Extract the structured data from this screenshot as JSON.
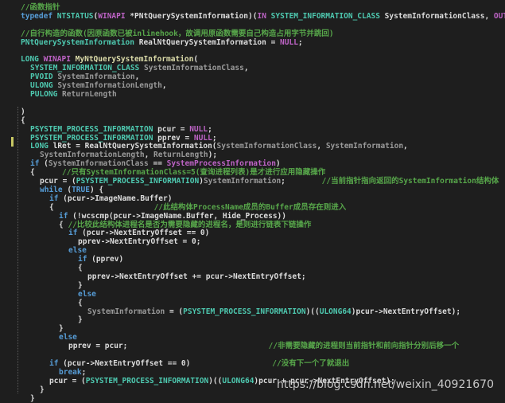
{
  "watermark": "https://blog.csdn.net/weixin_40921670",
  "lines": [
    {
      "indent": 0,
      "tokens": [
        [
          "com",
          "//函数指针"
        ]
      ]
    },
    {
      "indent": 0,
      "tokens": [
        [
          "kw",
          "typedef "
        ],
        [
          "type",
          "NTSTATUS"
        ],
        [
          "plain",
          "("
        ],
        [
          "macro",
          "WINAPI "
        ],
        [
          "plain",
          "*PNtQuerySystemInformation)("
        ],
        [
          "macro",
          "IN "
        ],
        [
          "type",
          "SYSTEM_INFORMATION_CLASS "
        ],
        [
          "plain",
          "SystemInformationClass, "
        ],
        [
          "macro",
          "OUT PV"
        ]
      ]
    },
    {
      "indent": 0,
      "tokens": []
    },
    {
      "indent": 0,
      "tokens": [
        [
          "com",
          "//自行构造的函数(因原函数已被inlinehook，故调用原函数需要自己构造占用字节并跳回)"
        ]
      ]
    },
    {
      "indent": 0,
      "tokens": [
        [
          "type",
          "PNtQuerySystemInformation "
        ],
        [
          "plain",
          "RealNtQuerySystemInformation = "
        ],
        [
          "macro",
          "NULL"
        ],
        [
          "plain",
          ";"
        ]
      ]
    },
    {
      "indent": 0,
      "tokens": []
    },
    {
      "indent": 0,
      "tokens": [
        [
          "type",
          "LONG "
        ],
        [
          "macro",
          "WINAPI "
        ],
        [
          "fn",
          "MyNtQuerySystemInformation"
        ],
        [
          "plain",
          "("
        ]
      ]
    },
    {
      "indent": 1,
      "tokens": [
        [
          "type",
          "SYSTEM_INFORMATION_CLASS "
        ],
        [
          "param",
          "SystemInformationClass"
        ],
        [
          "plain",
          ","
        ]
      ]
    },
    {
      "indent": 1,
      "tokens": [
        [
          "type",
          "PVOID "
        ],
        [
          "param",
          "SystemInformation"
        ],
        [
          "plain",
          ","
        ]
      ]
    },
    {
      "indent": 1,
      "tokens": [
        [
          "type",
          "ULONG "
        ],
        [
          "param",
          "SystemInformationLength"
        ],
        [
          "plain",
          ","
        ]
      ]
    },
    {
      "indent": 1,
      "tokens": [
        [
          "type",
          "PULONG "
        ],
        [
          "param",
          "ReturnLength"
        ]
      ]
    },
    {
      "indent": 0,
      "tokens": []
    },
    {
      "indent": 0,
      "tokens": [
        [
          "plain",
          ")"
        ]
      ]
    },
    {
      "indent": 0,
      "tokens": [
        [
          "plain",
          "{"
        ]
      ]
    },
    {
      "indent": 1,
      "tokens": [
        [
          "type",
          "PSYSTEM_PROCESS_INFORMATION "
        ],
        [
          "plain",
          "pcur = "
        ],
        [
          "macro",
          "NULL"
        ],
        [
          "plain",
          ";"
        ]
      ]
    },
    {
      "indent": 1,
      "tokens": [
        [
          "type",
          "PSYSTEM_PROCESS_INFORMATION "
        ],
        [
          "plain",
          "pprev = "
        ],
        [
          "macro",
          "NULL"
        ],
        [
          "plain",
          ";"
        ]
      ]
    },
    {
      "indent": 1,
      "tokens": [
        [
          "type",
          "LONG "
        ],
        [
          "plain",
          "lRet = RealNtQuerySystemInformation("
        ],
        [
          "param",
          "SystemInformationClass"
        ],
        [
          "plain",
          ", "
        ],
        [
          "param",
          "SystemInformation"
        ],
        [
          "plain",
          ","
        ]
      ]
    },
    {
      "indent": 2,
      "tokens": [
        [
          "param",
          "SystemInformationLength"
        ],
        [
          "plain",
          ", "
        ],
        [
          "param",
          "ReturnLength"
        ],
        [
          "plain",
          ");"
        ]
      ]
    },
    {
      "indent": 1,
      "tokens": [
        [
          "kw",
          "if "
        ],
        [
          "plain",
          "("
        ],
        [
          "param",
          "SystemInformationClass "
        ],
        [
          "plain",
          "== "
        ],
        [
          "macro",
          "SystemProcessInformation"
        ],
        [
          "plain",
          ")"
        ]
      ]
    },
    {
      "indent": 1,
      "tokens": [
        [
          "plain",
          "{      "
        ],
        [
          "com",
          "//只有SystemInformationClass=5(查询进程列表)是才进行应用隐藏操作"
        ]
      ]
    },
    {
      "indent": 2,
      "tokens": [
        [
          "plain",
          "pcur = ("
        ],
        [
          "type",
          "PSYSTEM_PROCESS_INFORMATION"
        ],
        [
          "plain",
          ")"
        ],
        [
          "param",
          "SystemInformation"
        ],
        [
          "plain",
          ";        "
        ],
        [
          "com",
          "//当前指针指向返回的SystemInformation结构体"
        ]
      ]
    },
    {
      "indent": 2,
      "tokens": [
        [
          "kw",
          "while "
        ],
        [
          "plain",
          "("
        ],
        [
          "kw",
          "TRUE"
        ],
        [
          "plain",
          ") {"
        ]
      ]
    },
    {
      "indent": 3,
      "tokens": [
        [
          "kw",
          "if "
        ],
        [
          "plain",
          "(pcur->ImageName.Buffer)"
        ]
      ]
    },
    {
      "indent": 3,
      "tokens": [
        [
          "plain",
          "{                      "
        ],
        [
          "com",
          "//此结构体ProcessName成员的Buffer成员存在则进入"
        ]
      ]
    },
    {
      "indent": 4,
      "tokens": [
        [
          "kw",
          "if "
        ],
        [
          "plain",
          "(!wcscmp(pcur->ImageName.Buffer, Hide_Process))"
        ]
      ]
    },
    {
      "indent": 4,
      "tokens": [
        [
          "plain",
          "{ "
        ],
        [
          "com",
          "//比较此结构体进程名是否为需要隐藏的进程名，是则进行链表下链操作"
        ]
      ]
    },
    {
      "indent": 5,
      "tokens": [
        [
          "kw",
          "if "
        ],
        [
          "plain",
          "(pcur->NextEntryOffset == 0)"
        ]
      ]
    },
    {
      "indent": 6,
      "tokens": [
        [
          "plain",
          "pprev->NextEntryOffset = 0;"
        ]
      ]
    },
    {
      "indent": 5,
      "tokens": [
        [
          "kw",
          "else"
        ]
      ]
    },
    {
      "indent": 6,
      "tokens": [
        [
          "kw",
          "if "
        ],
        [
          "plain",
          "(pprev)"
        ]
      ]
    },
    {
      "indent": 6,
      "tokens": [
        [
          "plain",
          "{"
        ]
      ]
    },
    {
      "indent": 7,
      "tokens": [
        [
          "plain",
          "pprev->NextEntryOffset += pcur->NextEntryOffset;"
        ]
      ]
    },
    {
      "indent": 6,
      "tokens": [
        [
          "plain",
          "}"
        ]
      ]
    },
    {
      "indent": 6,
      "tokens": [
        [
          "kw",
          "else"
        ]
      ]
    },
    {
      "indent": 6,
      "tokens": [
        [
          "plain",
          "{"
        ]
      ]
    },
    {
      "indent": 7,
      "tokens": [
        [
          "param",
          "SystemInformation "
        ],
        [
          "plain",
          "= ("
        ],
        [
          "type",
          "PSYSTEM_PROCESS_INFORMATION"
        ],
        [
          "plain",
          ")(("
        ],
        [
          "type",
          "ULONG64"
        ],
        [
          "plain",
          ")pcur->NextEntryOffset);"
        ]
      ]
    },
    {
      "indent": 6,
      "tokens": [
        [
          "plain",
          "}"
        ]
      ]
    },
    {
      "indent": 4,
      "tokens": [
        [
          "plain",
          "}"
        ]
      ]
    },
    {
      "indent": 4,
      "tokens": [
        [
          "kw",
          "else"
        ]
      ]
    },
    {
      "indent": 5,
      "tokens": [
        [
          "plain",
          "pprev = pcur;                               "
        ],
        [
          "com",
          "//非需要隐藏的进程则当前指针和前向指针分别后移一个"
        ]
      ]
    },
    {
      "indent": 3,
      "tokens": []
    },
    {
      "indent": 3,
      "tokens": [
        [
          "kw",
          "if "
        ],
        [
          "plain",
          "(pcur->NextEntryOffset == 0)                  "
        ],
        [
          "com",
          "//没有下一个了就退出"
        ]
      ]
    },
    {
      "indent": 4,
      "tokens": [
        [
          "kw",
          "break"
        ],
        [
          "plain",
          ";"
        ]
      ]
    },
    {
      "indent": 3,
      "tokens": [
        [
          "plain",
          "pcur = ("
        ],
        [
          "type",
          "PSYSTEM_PROCESS_INFORMATION"
        ],
        [
          "plain",
          ")(("
        ],
        [
          "type",
          "ULONG64"
        ],
        [
          "plain",
          ")pcur + pcur->NextEntryOffset);"
        ]
      ]
    },
    {
      "indent": 2,
      "tokens": [
        [
          "plain",
          "}"
        ]
      ]
    },
    {
      "indent": 1,
      "tokens": [
        [
          "plain",
          "}"
        ]
      ]
    }
  ]
}
